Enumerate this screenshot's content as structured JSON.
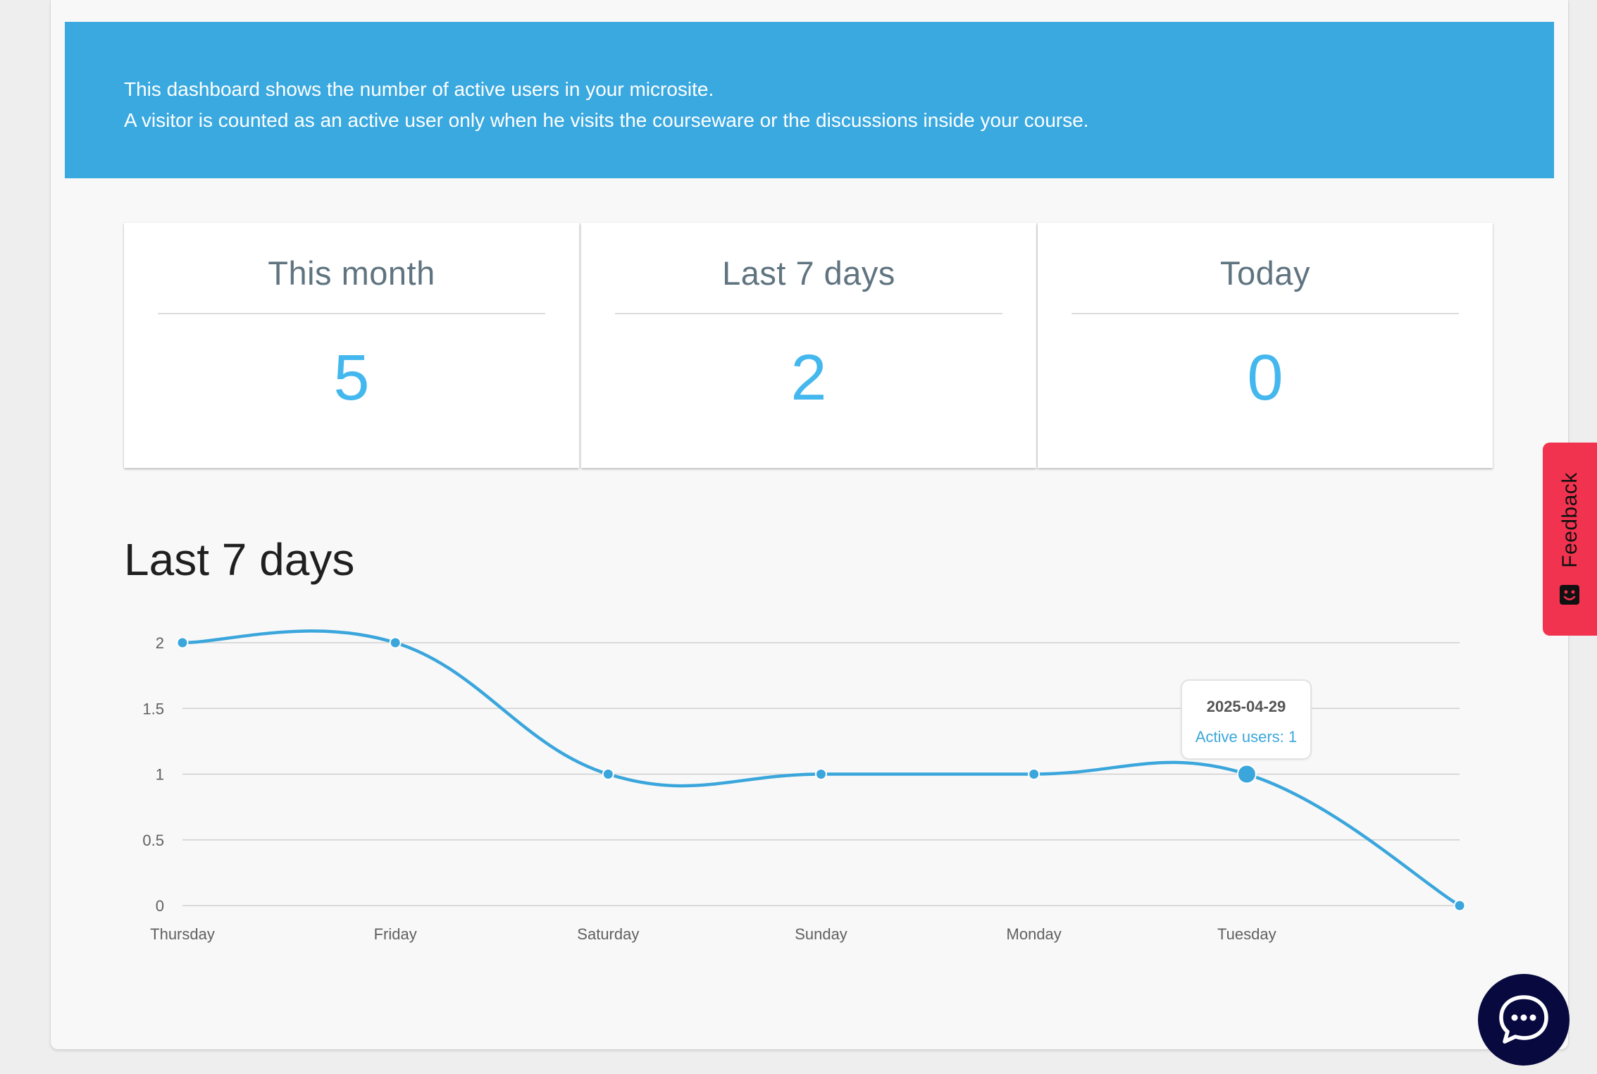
{
  "banner": {
    "line1": "This dashboard shows the number of active users in your microsite.",
    "line2": "A visitor is counted as an active user only when he visits the courseware or the discussions inside your course."
  },
  "stats": [
    {
      "label": "This month",
      "value": "5"
    },
    {
      "label": "Last 7 days",
      "value": "2"
    },
    {
      "label": "Today",
      "value": "0"
    }
  ],
  "section_title": "Last 7 days",
  "chart_data": {
    "type": "line",
    "title": "",
    "xlabel": "",
    "ylabel": "",
    "categories": [
      "Thursday",
      "Friday",
      "Saturday",
      "Sunday",
      "Monday",
      "Tuesday",
      ""
    ],
    "series": [
      {
        "values": [
          2,
          2,
          1,
          1,
          1,
          1,
          0
        ]
      }
    ],
    "ylim": [
      0,
      2
    ],
    "yticks": [
      "0",
      "0.5",
      "1",
      "1.5",
      "2"
    ],
    "grid": true,
    "line_color": "#3ba6dc",
    "tooltip": {
      "date": "2025-04-29",
      "text": "Active users: 1",
      "point_index": 5
    }
  },
  "feedback": {
    "label": "Feedback",
    "color": "#f2334f"
  },
  "chat": {
    "icon": "chat-bubble-icon"
  },
  "colors": {
    "banner": "#3aa9e0",
    "accent": "#44b8ee",
    "chat": "#07093f"
  }
}
